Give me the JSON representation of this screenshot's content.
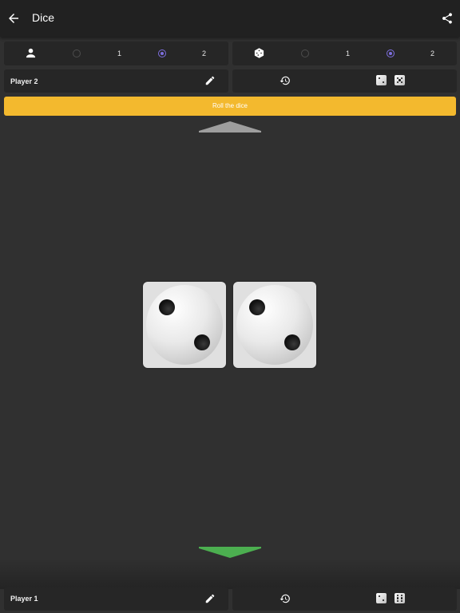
{
  "app": {
    "title": "Dice"
  },
  "icons": {
    "back": "arrow-back-icon",
    "share": "share-icon",
    "players": "person-icon",
    "dice_count": "die-icon",
    "edit": "pencil-icon",
    "history": "history-icon",
    "dice_two": "die-face-two-icon",
    "dice_five": "die-face-five-icon",
    "dice_six": "die-face-six-icon"
  },
  "settings": {
    "players": {
      "options": [
        "1",
        "2"
      ],
      "selected": "2"
    },
    "dice": {
      "options": [
        "1",
        "2"
      ],
      "selected": "2"
    }
  },
  "top_player": {
    "name": "Player 2"
  },
  "roll_button": {
    "label": "Roll the dice"
  },
  "dice": [
    {
      "value": 2
    },
    {
      "value": 2
    }
  ],
  "bottom_player": {
    "name": "Player 1"
  },
  "colors": {
    "accent": "#f3b92e",
    "radio_selected": "#7e6fe0",
    "turn_arrow_active": "#4caf50",
    "turn_arrow_inactive": "#9e9e9e",
    "background": "#303030",
    "panel": "#262626"
  }
}
